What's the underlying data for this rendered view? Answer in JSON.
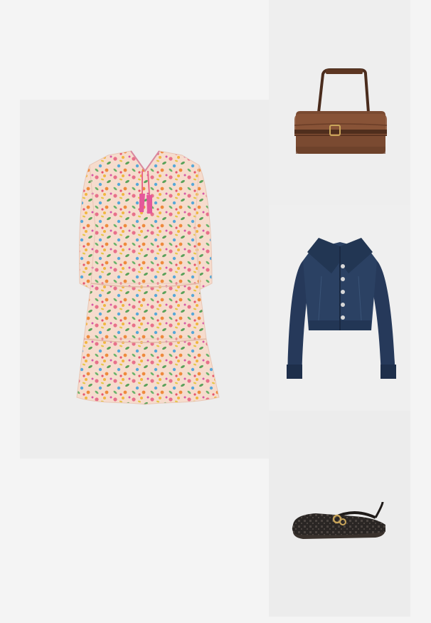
{
  "outfit": {
    "items": [
      {
        "id": "dress",
        "icon": "floral-tiered-dress",
        "colors": {
          "base": "#f6dccd",
          "accent": "#e86a8a"
        }
      },
      {
        "id": "bag",
        "icon": "brown-suede-shoulder-bag",
        "colors": {
          "base": "#7a4a31"
        }
      },
      {
        "id": "jacket",
        "icon": "cropped-denim-jacket",
        "colors": {
          "base": "#253a57"
        }
      },
      {
        "id": "shoe",
        "icon": "woven-black-ballet-flat",
        "colors": {
          "base": "#2a2624"
        }
      }
    ]
  },
  "theme": {
    "page_background": "#f4f4f4",
    "tile_background": "#ededed"
  }
}
